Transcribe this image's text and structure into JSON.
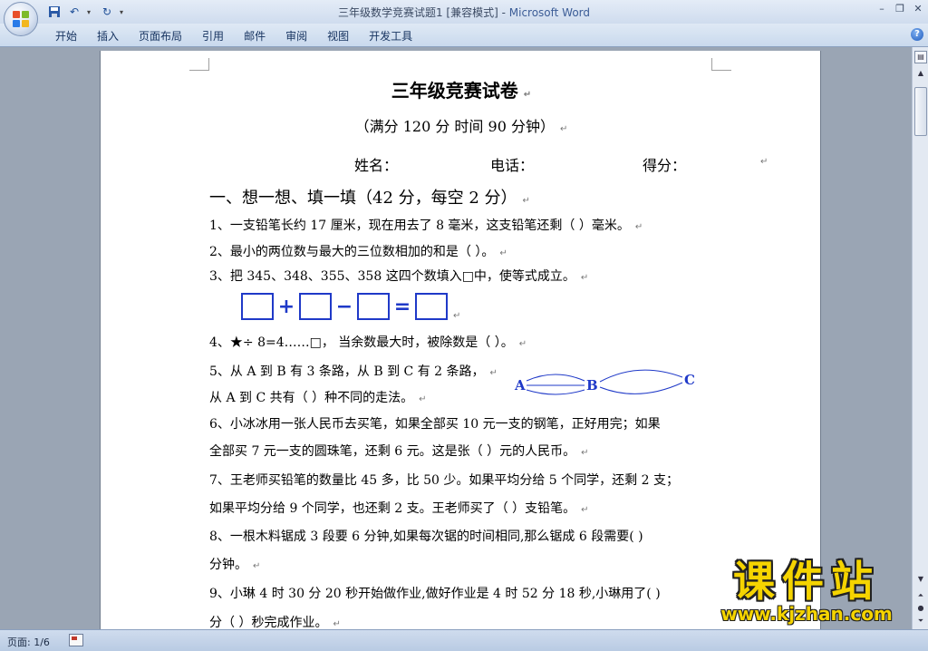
{
  "window": {
    "title": "三年级数学竞赛试题1 [兼容模式] - ",
    "app_name": "Microsoft Word"
  },
  "ribbon": {
    "tabs": [
      "开始",
      "插入",
      "页面布局",
      "引用",
      "邮件",
      "审阅",
      "视图",
      "开发工具"
    ]
  },
  "document": {
    "title": "三年级竞赛试卷",
    "subtitle": "（满分 120 分    时间 90 分钟）",
    "info": {
      "name": "姓名：",
      "phone": "电话：",
      "score": "得分："
    },
    "section1": "一、想一想、填一填（42 分，每空 2 分）",
    "lines": [
      "1、一支铅笔长约 17 厘米，现在用去了 8 毫米，这支铅笔还剩（       ）毫米。",
      "2、最小的两位数与最大的三位数相加的和是（           ）。",
      "3、把 345、348、355、358 这四个数填入□中，使等式成立。",
      "4、★÷ 8=4……□， 当余数最大时，被除数是（          ）。",
      "5、从 A 到 B 有 3 条路，从 B 到 C 有 2 条路，",
      "从 A 到 C 共有（       ）种不同的走法。",
      "6、小冰冰用一张人民币去买笔，如果全部买 10 元一支的钢笔，正好用完；如果",
      "全部买 7 元一支的圆珠笔，还剩 6 元。这是张（          ）元的人民币。",
      "7、王老师买铅笔的数量比 45 多，比 50 少。如果平均分给 5 个同学，还剩 2 支；",
      "如果平均分给 9 个同学，也还剩 2 支。王老师买了（       ）支铅笔。",
      "8、一根木料锯成 3 段要 6 分钟,如果每次锯的时间相同,那么锯成 6 段需要(      )",
      "分钟。",
      "9、小琳 4 时 30 分 20 秒开始做作业,做好作业是 4 时 52 分 18 秒,小琳用了(      )",
      "分（       ）秒完成作业。"
    ],
    "equation_ops": [
      "+",
      "−",
      "="
    ],
    "route_labels": {
      "a": "A",
      "b": "B",
      "c": "C"
    }
  },
  "status": {
    "page": "页面: 1/6"
  },
  "watermark": {
    "cn": "课件站",
    "url": "www.kjzhan.com"
  },
  "colors": {
    "accent": "#1f39c8",
    "watermark": "#f5d400"
  }
}
